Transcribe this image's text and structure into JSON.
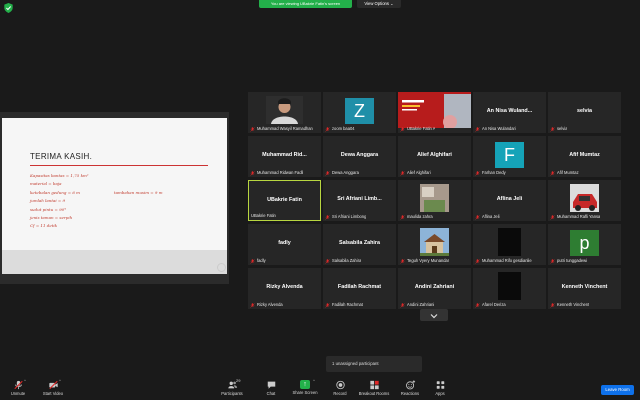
{
  "top_bar": {
    "viewing_banner": "You are viewing UBakrie Fatin's screen",
    "view_options": "View Options ⌄"
  },
  "slide": {
    "title": "TERIMA KASIH.",
    "notes": [
      "Kapasitas bantas = 1,75 km²",
      "material = baja",
      "ketebalan gedung = 6 m",
      "jumlah lantai = 9",
      "sudut pintu = 90°",
      "jenis taman = serpih",
      "Cf = 11 detik"
    ],
    "notes_right": "tambahan musim = 9 m"
  },
  "participants": [
    {
      "display": "",
      "label": "Muhammad Wasyil Ramadhan",
      "muted": true,
      "type": "photo-person"
    },
    {
      "display": "Z",
      "label": "zoom baa04",
      "muted": true,
      "type": "avatar",
      "color": "#1f8fa8"
    },
    {
      "display": "",
      "label": "UBakrie Fatin A",
      "muted": true,
      "type": "photo-banner"
    },
    {
      "display": "An Nisa Wuland...",
      "label": "An Nisa Wulandari",
      "muted": true,
      "type": "name"
    },
    {
      "display": "selvia",
      "label": "selvia",
      "muted": true,
      "type": "name"
    },
    {
      "display": "Muhammad  Rid...",
      "label": "Muhammad Ridwan Fadli",
      "muted": true,
      "type": "name"
    },
    {
      "display": "Dewa Anggara",
      "label": "Dewa Anggara",
      "muted": true,
      "type": "name"
    },
    {
      "display": "Alief Alghifari",
      "label": "Alief Alghifari",
      "muted": true,
      "type": "name"
    },
    {
      "display": "F",
      "label": "Farhan Dedy",
      "muted": true,
      "type": "avatar",
      "color": "#15a3b8"
    },
    {
      "display": "Afif Mumtaz",
      "label": "Afif Mumtaz",
      "muted": true,
      "type": "name"
    },
    {
      "display": "UBakrie Fatin",
      "label": "UBakrie Fatin",
      "muted": false,
      "type": "name",
      "active": true
    },
    {
      "display": "Sri Afriani Limb...",
      "label": "Sri Afriani Limbong",
      "muted": true,
      "type": "name"
    },
    {
      "display": "",
      "label": "maulida zahra",
      "muted": true,
      "type": "photo-room"
    },
    {
      "display": "Aflina Jeli",
      "label": "Aflina Jeli",
      "muted": true,
      "type": "name"
    },
    {
      "display": "",
      "label": "Muhammad Rafli Yansa",
      "muted": true,
      "type": "photo-car"
    },
    {
      "display": "fadly",
      "label": "fadly",
      "muted": true,
      "type": "name"
    },
    {
      "display": "Salsabila Zahira",
      "label": "Salsabila Zahira",
      "muted": true,
      "type": "name"
    },
    {
      "display": "",
      "label": "Teguh Vyery Munandar",
      "muted": true,
      "type": "photo-building"
    },
    {
      "display": "",
      "label": "Muhammad Rifo gesdianlie",
      "muted": true,
      "type": "photo-dark"
    },
    {
      "display": "p",
      "label": "putri tunggadewi",
      "muted": true,
      "type": "avatar",
      "color": "#2e7d32"
    },
    {
      "display": "Rizky Alvenda",
      "label": "Rizky Alvenda",
      "muted": true,
      "type": "name"
    },
    {
      "display": "Fadilah Rachmat",
      "label": "Fadilah Rachmat",
      "muted": true,
      "type": "name"
    },
    {
      "display": "Andini Zahriani",
      "label": "Andini Zahriani",
      "muted": true,
      "type": "name"
    },
    {
      "display": "",
      "label": "Afarel Deriza",
      "muted": true,
      "type": "photo-dark"
    },
    {
      "display": "Kenneth Vinchent",
      "label": "Kenneth Vinchent",
      "muted": true,
      "type": "name"
    }
  ],
  "unassigned": "1 unassigned participant",
  "toolbar": {
    "unmute": "Unmute",
    "start_video": "Start Video",
    "participants": "Participants",
    "participants_count": "29",
    "chat": "Chat",
    "share_screen": "Share Screen",
    "record": "Record",
    "breakout_rooms": "Breakout Rooms",
    "reactions": "Reactions",
    "apps": "Apps",
    "leave": "Leave Room"
  },
  "colors": {
    "share_green": "#23b04a",
    "leave_blue": "#0e71eb",
    "active_speaker": "#b8d640",
    "muted_red": "#e02828"
  }
}
